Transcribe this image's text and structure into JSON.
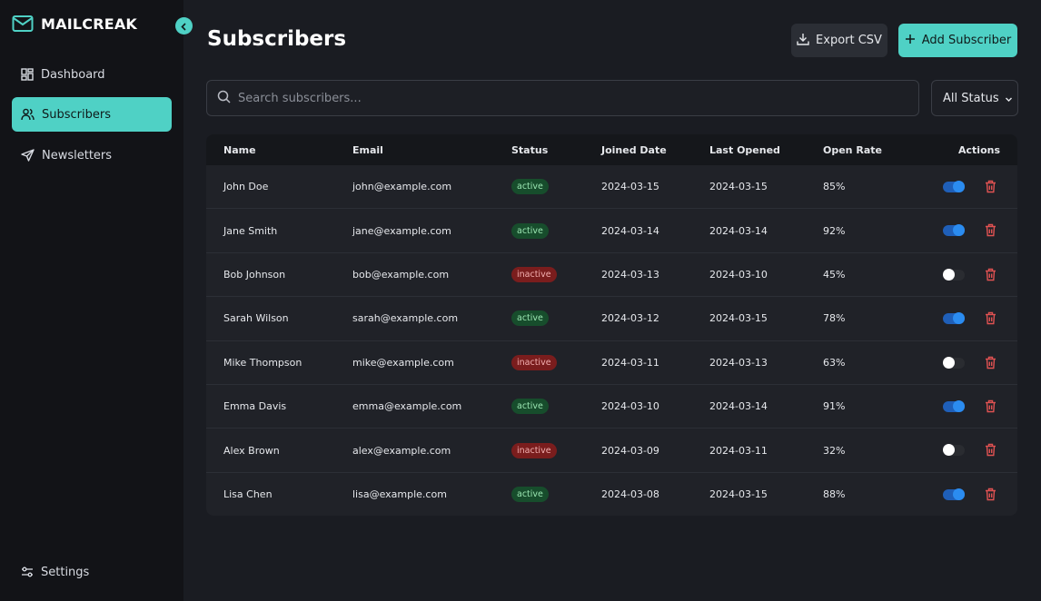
{
  "app": {
    "brand": "MAILCREAK",
    "accent": "#4fd1c5"
  },
  "sidebar": {
    "items": [
      {
        "label": "Dashboard",
        "icon": "dashboard-icon",
        "active": false
      },
      {
        "label": "Subscribers",
        "icon": "users-icon",
        "active": true
      },
      {
        "label": "Newsletters",
        "icon": "send-icon",
        "active": false
      }
    ],
    "settings_label": "Settings"
  },
  "header": {
    "title": "Subscribers",
    "export_label": "Export CSV",
    "add_label": "Add Subscriber"
  },
  "filters": {
    "search_placeholder": "Search subscribers...",
    "status_value": "All Status"
  },
  "table": {
    "columns": [
      "Name",
      "Email",
      "Status",
      "Joined Date",
      "Last Opened",
      "Open Rate",
      "Actions"
    ],
    "rows": [
      {
        "name": "John Doe",
        "email": "john@example.com",
        "status": "active",
        "joined": "2024-03-15",
        "last_opened": "2024-03-15",
        "open_rate": "85%",
        "enabled": true
      },
      {
        "name": "Jane Smith",
        "email": "jane@example.com",
        "status": "active",
        "joined": "2024-03-14",
        "last_opened": "2024-03-14",
        "open_rate": "92%",
        "enabled": true
      },
      {
        "name": "Bob Johnson",
        "email": "bob@example.com",
        "status": "inactive",
        "joined": "2024-03-13",
        "last_opened": "2024-03-10",
        "open_rate": "45%",
        "enabled": false
      },
      {
        "name": "Sarah Wilson",
        "email": "sarah@example.com",
        "status": "active",
        "joined": "2024-03-12",
        "last_opened": "2024-03-15",
        "open_rate": "78%",
        "enabled": true
      },
      {
        "name": "Mike Thompson",
        "email": "mike@example.com",
        "status": "inactive",
        "joined": "2024-03-11",
        "last_opened": "2024-03-13",
        "open_rate": "63%",
        "enabled": false
      },
      {
        "name": "Emma Davis",
        "email": "emma@example.com",
        "status": "active",
        "joined": "2024-03-10",
        "last_opened": "2024-03-14",
        "open_rate": "91%",
        "enabled": true
      },
      {
        "name": "Alex Brown",
        "email": "alex@example.com",
        "status": "inactive",
        "joined": "2024-03-09",
        "last_opened": "2024-03-11",
        "open_rate": "32%",
        "enabled": false
      },
      {
        "name": "Lisa Chen",
        "email": "lisa@example.com",
        "status": "active",
        "joined": "2024-03-08",
        "last_opened": "2024-03-15",
        "open_rate": "88%",
        "enabled": true
      }
    ]
  }
}
